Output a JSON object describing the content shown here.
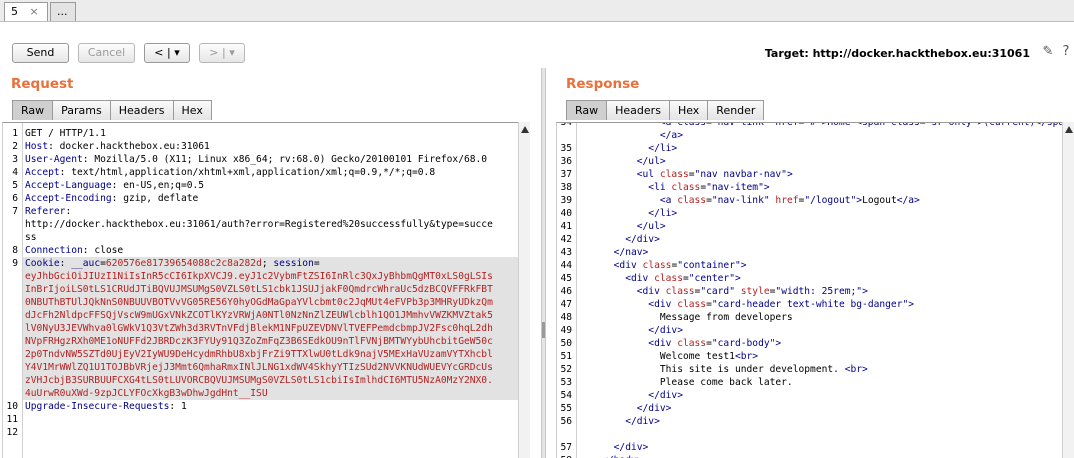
{
  "tabs": [
    {
      "label": "5",
      "close": "×"
    },
    {
      "label": "..."
    }
  ],
  "toolbar": {
    "send": "Send",
    "cancel": "Cancel",
    "back": "< | ▾",
    "forward": "> | ▾",
    "target": "Target: http://docker.hackthebox.eu:31061"
  },
  "request": {
    "title": "Request",
    "tabs": [
      "Raw",
      "Params",
      "Headers",
      "Hex"
    ],
    "lines": [
      {
        "n": "1",
        "seg": [
          [
            "GET / HTTP/1.1",
            "k-dark"
          ]
        ]
      },
      {
        "n": "2",
        "seg": [
          [
            "Host",
            "k-blue"
          ],
          [
            ": docker.hackthebox.eu:31061",
            "k-dark"
          ]
        ]
      },
      {
        "n": "3",
        "seg": [
          [
            "User-Agent",
            "k-blue"
          ],
          [
            ": Mozilla/5.0 (X11; Linux x86_64; rv:68.0) Gecko/20100101 Firefox/68.0",
            "k-dark"
          ]
        ]
      },
      {
        "n": "4",
        "seg": [
          [
            "Accept",
            "k-blue"
          ],
          [
            ": text/html,application/xhtml+xml,application/xml;q=0.9,*/*;q=0.8",
            "k-dark"
          ]
        ]
      },
      {
        "n": "5",
        "seg": [
          [
            "Accept-Language",
            "k-blue"
          ],
          [
            ": en-US,en;q=0.5",
            "k-dark"
          ]
        ]
      },
      {
        "n": "6",
        "seg": [
          [
            "Accept-Encoding",
            "k-blue"
          ],
          [
            ": gzip, deflate",
            "k-dark"
          ]
        ]
      },
      {
        "n": "7",
        "seg": [
          [
            "Referer",
            "k-blue"
          ],
          [
            ":",
            "k-dark"
          ]
        ]
      },
      {
        "n": "",
        "seg": [
          [
            "http://docker.hackthebox.eu:31061/auth?error=Registered%20successfully&type=succe",
            "k-dark"
          ]
        ]
      },
      {
        "n": "",
        "seg": [
          [
            "ss",
            "k-dark"
          ]
        ]
      },
      {
        "n": "8",
        "seg": [
          [
            "Connection",
            "k-blue"
          ],
          [
            ": close",
            "k-dark"
          ]
        ]
      },
      {
        "n": "9",
        "seg": [
          [
            "Cookie",
            "k-blue"
          ],
          [
            ": ",
            "k-dark"
          ],
          [
            "__auc",
            "k-blue"
          ],
          [
            "=",
            "k-dark"
          ],
          [
            "620576e81739654088c2c8a282d",
            "k-red"
          ],
          [
            "; ",
            "k-dark"
          ],
          [
            "session",
            "k-blue"
          ],
          [
            "=",
            "k-dark"
          ]
        ],
        "hl": true
      },
      {
        "n": "",
        "seg": [
          [
            "eyJhbGciOiJIUzI1NiIsInR5cCI6IkpXVCJ9.eyJ1c2VybmFtZSI6InRlc3QxJyBhbmQgMT0xLS0gLSIs",
            "k-red"
          ]
        ],
        "hl": true
      },
      {
        "n": "",
        "seg": [
          [
            "InBrIjoiLS0tLS1CRUdJTiBQVUJMSUMgS0VZLS0tLS1cbk1JSUJjakF0QmdrcWhraUc5dzBCQVFFRkFBT",
            "k-red"
          ]
        ],
        "hl": true
      },
      {
        "n": "",
        "seg": [
          [
            "0NBUThBTUlJQkNnS0NBUUVBOTVvVG05RE56Y0hyOGdMaGpaYVlcbmt0c2JqMUt4eFVPb3p3MHRyUDkzQm",
            "k-red"
          ]
        ],
        "hl": true
      },
      {
        "n": "",
        "seg": [
          [
            "dJcFh2NldpcFFSQjVscW9mUGxVNkZCOTlKYzVRWjA0NTl0NzNnZlZEUWlcblh1QO1JMmhvVWZKMVZtak5",
            "k-red"
          ]
        ],
        "hl": true
      },
      {
        "n": "",
        "seg": [
          [
            "lV0NyU3JEVWhva0lGWkV1Q3VtZWh3d3RVTnVFdjBlekM1NFpUZEVDNVlTVEFPemdcbmpJV2Fsc0hqL2dh",
            "k-red"
          ]
        ],
        "hl": true
      },
      {
        "n": "",
        "seg": [
          [
            "NVpFRHgzRXh0ME1oNUFFd2JBRDczK3FYUy91Q3ZoZmFqZ3B6SEdkOU9nTlFVNjBMTWYybUhcbitGeW50c",
            "k-red"
          ]
        ],
        "hl": true
      },
      {
        "n": "",
        "seg": [
          [
            "2p0TndvNW5SZTd0UjEyV2IyWU9DeHcydmRhbU8xbjFrZi9TTXlwU0tLdk9najV5MExHaVUzamVYTXhcbl",
            "k-red"
          ]
        ],
        "hl": true
      },
      {
        "n": "",
        "seg": [
          [
            "Y4V1MrWWlZQ1U1TOJBbVRjejJ3Mmt6QmhaRmxINlJLNG1xdWV4SkhyYTIzSUd2NVVKNUdWUEVYcGRDcUs",
            "k-red"
          ]
        ],
        "hl": true
      },
      {
        "n": "",
        "seg": [
          [
            "zVHJcbjB3SURBUUFCXG4tLS0tLUVORCBQVUJMSUMgS0VZLS0tLS1cbiIsImlhdCI6MTU5NzA0MzY2NX0.",
            "k-red"
          ]
        ],
        "hl": true
      },
      {
        "n": "",
        "seg": [
          [
            "4uUrwR0uXWd-9zpJCLYFOcXkgB3wDhwJgdHnt__ISU",
            "k-red"
          ]
        ],
        "hl": true
      },
      {
        "n": "10",
        "seg": [
          [
            "Upgrade-Insecure-Requests",
            "k-blue"
          ],
          [
            ": 1",
            "k-dark"
          ]
        ]
      },
      {
        "n": "11",
        "seg": [
          [
            "",
            "k-dark"
          ]
        ]
      },
      {
        "n": "12",
        "seg": [
          [
            "",
            "k-dark"
          ]
        ]
      }
    ]
  },
  "response": {
    "title": "Response",
    "tabs": [
      "Raw",
      "Headers",
      "Hex",
      "Render"
    ],
    "lines": [
      {
        "n": "34",
        "seg": [
          [
            "              ",
            "k-dark"
          ],
          [
            "<a class=\"nav-link\" href=\"#\">Home <span class=\"sr-only\">(current)</span>",
            "k-blue"
          ]
        ]
      },
      {
        "n": "",
        "seg": [
          [
            "              </a>",
            "k-blue"
          ]
        ]
      },
      {
        "n": "35",
        "seg": [
          [
            "            </li>",
            "k-blue"
          ]
        ]
      },
      {
        "n": "36",
        "seg": [
          [
            "          </ul>",
            "k-blue"
          ]
        ]
      },
      {
        "n": "37",
        "seg": [
          [
            "          <ul ",
            "k-blue"
          ],
          [
            "class",
            "k-red"
          ],
          [
            "=",
            "k-dark"
          ],
          [
            "\"nav navbar-nav\"",
            "k-blue"
          ],
          [
            ">",
            "k-blue"
          ]
        ]
      },
      {
        "n": "38",
        "seg": [
          [
            "            <li ",
            "k-blue"
          ],
          [
            "class",
            "k-red"
          ],
          [
            "=",
            "k-dark"
          ],
          [
            "\"nav-item\"",
            "k-blue"
          ],
          [
            ">",
            "k-blue"
          ]
        ]
      },
      {
        "n": "39",
        "seg": [
          [
            "              <a ",
            "k-blue"
          ],
          [
            "class",
            "k-red"
          ],
          [
            "=",
            "k-dark"
          ],
          [
            "\"nav-link\"",
            "k-blue"
          ],
          [
            " ",
            "k-dark"
          ],
          [
            "href",
            "k-red"
          ],
          [
            "=",
            "k-dark"
          ],
          [
            "\"/logout\"",
            "k-blue"
          ],
          [
            ">",
            "k-blue"
          ],
          [
            "Logout",
            "k-dark"
          ],
          [
            "</a>",
            "k-blue"
          ]
        ]
      },
      {
        "n": "40",
        "seg": [
          [
            "            </li>",
            "k-blue"
          ]
        ]
      },
      {
        "n": "41",
        "seg": [
          [
            "          </ul>",
            "k-blue"
          ]
        ]
      },
      {
        "n": "42",
        "seg": [
          [
            "        </div>",
            "k-blue"
          ]
        ]
      },
      {
        "n": "43",
        "seg": [
          [
            "      </nav>",
            "k-blue"
          ]
        ]
      },
      {
        "n": "44",
        "seg": [
          [
            "      <div ",
            "k-blue"
          ],
          [
            "class",
            "k-red"
          ],
          [
            "=",
            "k-dark"
          ],
          [
            "\"container\"",
            "k-blue"
          ],
          [
            ">",
            "k-blue"
          ]
        ]
      },
      {
        "n": "45",
        "seg": [
          [
            "        <div ",
            "k-blue"
          ],
          [
            "class",
            "k-red"
          ],
          [
            "=",
            "k-dark"
          ],
          [
            "\"center\"",
            "k-blue"
          ],
          [
            ">",
            "k-blue"
          ]
        ]
      },
      {
        "n": "46",
        "seg": [
          [
            "          <div ",
            "k-blue"
          ],
          [
            "class",
            "k-red"
          ],
          [
            "=",
            "k-dark"
          ],
          [
            "\"card\"",
            "k-blue"
          ],
          [
            " ",
            "k-dark"
          ],
          [
            "style",
            "k-red"
          ],
          [
            "=",
            "k-dark"
          ],
          [
            "\"width: 25rem;\"",
            "k-blue"
          ],
          [
            ">",
            "k-blue"
          ]
        ]
      },
      {
        "n": "47",
        "seg": [
          [
            "            <div ",
            "k-blue"
          ],
          [
            "class",
            "k-red"
          ],
          [
            "=",
            "k-dark"
          ],
          [
            "\"card-header text-white bg-danger\"",
            "k-blue"
          ],
          [
            ">",
            "k-blue"
          ]
        ]
      },
      {
        "n": "48",
        "seg": [
          [
            "              Message from developers",
            "k-dark"
          ]
        ]
      },
      {
        "n": "49",
        "seg": [
          [
            "            </div>",
            "k-blue"
          ]
        ]
      },
      {
        "n": "50",
        "seg": [
          [
            "            <div ",
            "k-blue"
          ],
          [
            "class",
            "k-red"
          ],
          [
            "=",
            "k-dark"
          ],
          [
            "\"card-body\"",
            "k-blue"
          ],
          [
            ">",
            "k-blue"
          ]
        ]
      },
      {
        "n": "51",
        "seg": [
          [
            "              Welcome test1",
            "k-dark"
          ],
          [
            "<br>",
            "k-blue"
          ]
        ]
      },
      {
        "n": "52",
        "seg": [
          [
            "              This site is under development. ",
            "k-dark"
          ],
          [
            "<br>",
            "k-blue"
          ]
        ]
      },
      {
        "n": "53",
        "seg": [
          [
            "              Please come back later.",
            "k-dark"
          ]
        ]
      },
      {
        "n": "54",
        "seg": [
          [
            "            </div>",
            "k-blue"
          ]
        ]
      },
      {
        "n": "55",
        "seg": [
          [
            "          </div>",
            "k-blue"
          ]
        ]
      },
      {
        "n": "56",
        "seg": [
          [
            "        </div>",
            "k-blue"
          ]
        ]
      },
      {
        "n": "",
        "seg": [
          [
            "",
            "k-dark"
          ]
        ]
      },
      {
        "n": "57",
        "seg": [
          [
            "      </div>",
            "k-blue"
          ]
        ]
      },
      {
        "n": "58",
        "seg": [
          [
            "    </body>",
            "k-blue"
          ]
        ]
      }
    ]
  },
  "colors": {
    "accent": "#e8703a",
    "keyword": "#00008b",
    "value": "#b22222"
  }
}
